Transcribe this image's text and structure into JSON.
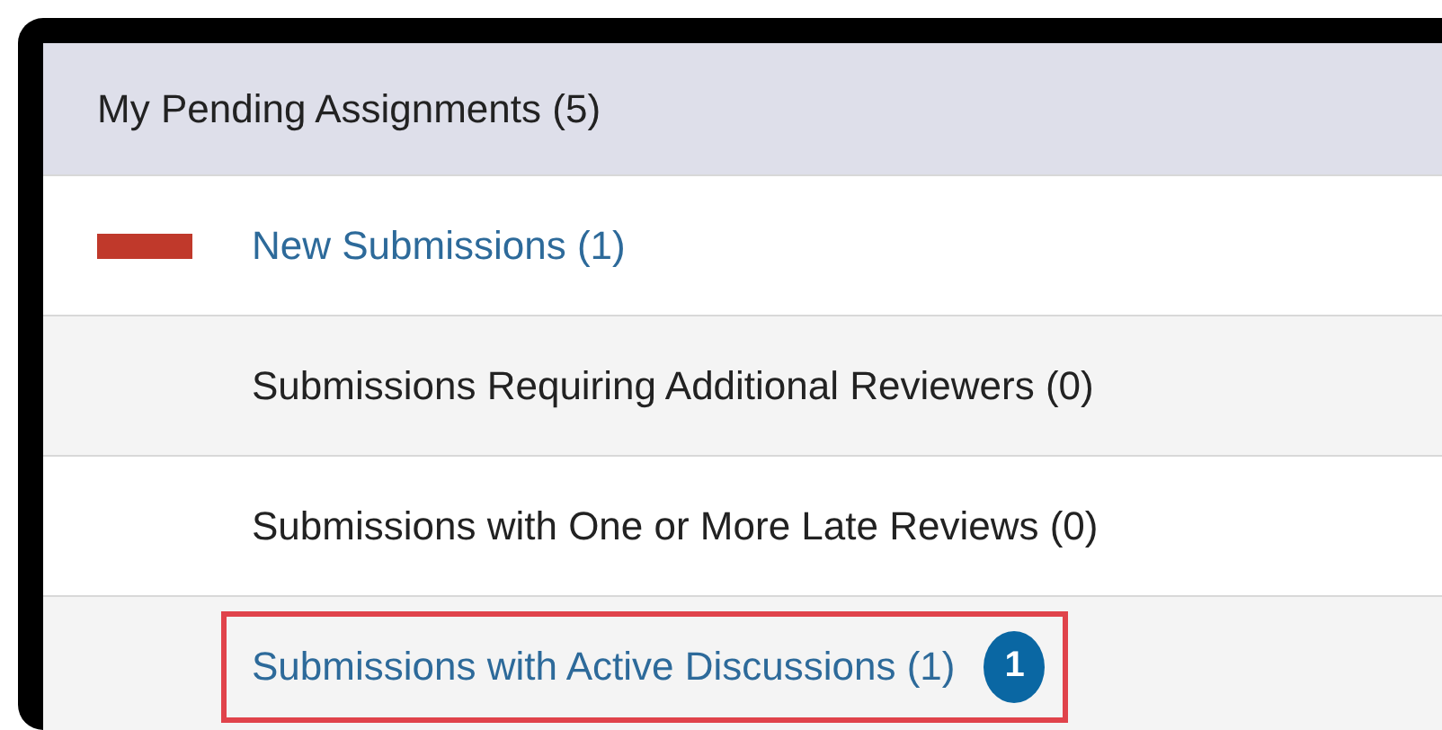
{
  "panel": {
    "title": "My Pending Assignments (5)",
    "rows": [
      {
        "label": "New Submissions (1)",
        "link": true,
        "new_marker": true,
        "highlighted": false
      },
      {
        "label": "Submissions Requiring Additional Reviewers (0)",
        "link": false,
        "new_marker": false,
        "highlighted": false
      },
      {
        "label": "Submissions with One or More Late Reviews (0)",
        "link": false,
        "new_marker": false,
        "highlighted": false
      },
      {
        "label": "Submissions with Active Discussions (1)",
        "link": true,
        "new_marker": false,
        "highlighted": true,
        "badge": "1"
      }
    ]
  }
}
